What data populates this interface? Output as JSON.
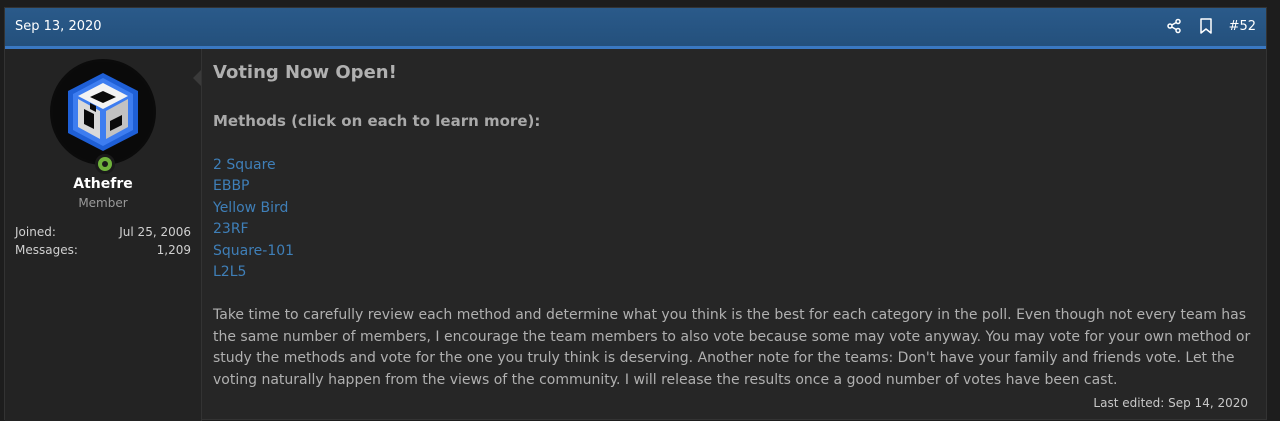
{
  "post": {
    "date": "Sep 13, 2020",
    "number": "#52",
    "icons": [
      "share-icon",
      "bookmark-icon"
    ]
  },
  "user": {
    "name": "Athefre",
    "title": "Member",
    "stats": [
      {
        "label": "Joined:",
        "value": "Jul 25, 2006"
      },
      {
        "label": "Messages:",
        "value": "1,209"
      }
    ]
  },
  "content": {
    "heading": "Voting Now Open!",
    "subheading": "Methods (click on each to learn more):",
    "links": [
      "2 Square",
      "EBBP",
      "Yellow Bird",
      "23RF",
      "Square-101",
      "L2L5"
    ],
    "paragraph": "Take time to carefully review each method and determine what you think is the best for each category in the poll. Even though not every team has the same number of members, I encourage the team members to also vote because some may vote anyway. You may vote for your own method or study the methods and vote for the one you truly think is deserving. Another note for the teams: Don't have your family and friends vote. Let the voting naturally happen from the views of the community. I will release the results once a good number of votes have been cast.",
    "last_edited": "Last edited: Sep 14, 2020"
  },
  "colors": {
    "header": "#2a5a8a",
    "header_border": "#3a78c2",
    "link": "#3f7fb8",
    "online": "#6fb33b"
  }
}
